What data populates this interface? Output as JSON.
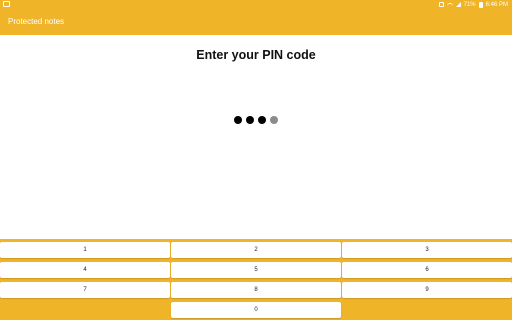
{
  "status_bar": {
    "battery": "71%",
    "time": "6:46 PM"
  },
  "app_bar": {
    "title": "Protected notes"
  },
  "pin": {
    "heading": "Enter your PIN code",
    "digits_total": 4,
    "digits_entered": 3
  },
  "keypad": {
    "keys": [
      "1",
      "2",
      "3",
      "4",
      "5",
      "6",
      "7",
      "8",
      "9",
      "0"
    ]
  },
  "colors": {
    "accent": "#f0b429",
    "dot_filled": "#000000",
    "dot_empty": "#8c8c8c"
  },
  "icons": [
    "screenshot-icon",
    "mute-icon",
    "wifi-icon",
    "signal-icon",
    "battery-icon"
  ]
}
